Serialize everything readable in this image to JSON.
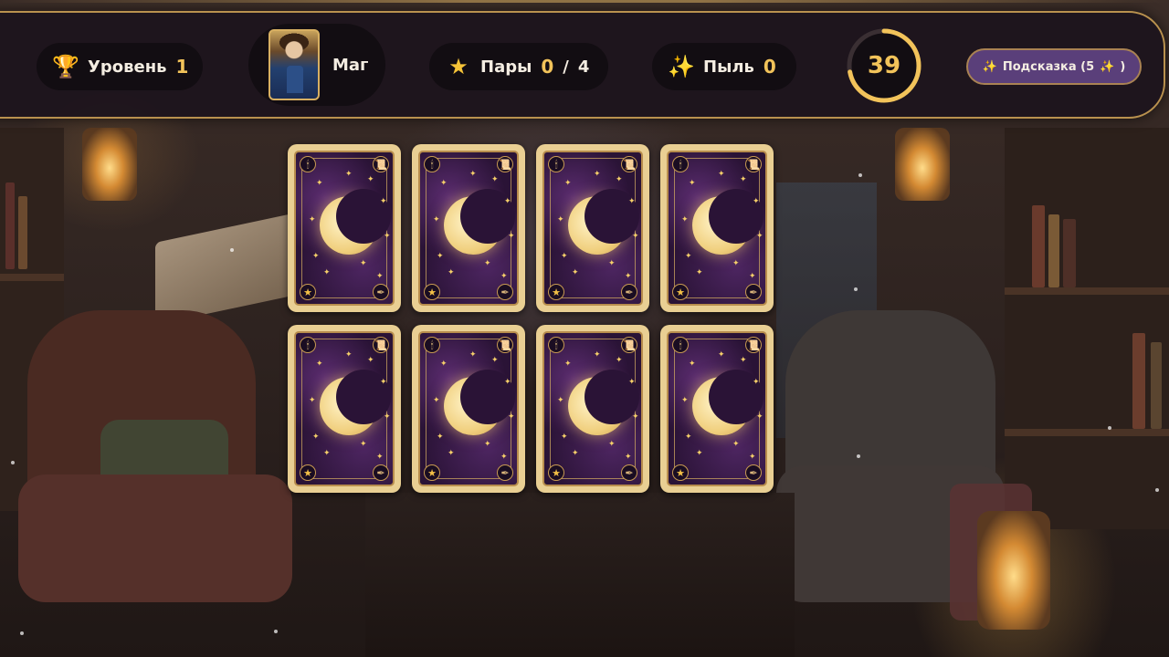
{
  "hud": {
    "level_label": "Уровень",
    "level_value": "1",
    "character_name": "Маг",
    "pairs_label": "Пары",
    "pairs_found": "0",
    "pairs_separator": "/",
    "pairs_total": "4",
    "dust_label": "Пыль",
    "dust_value": "0",
    "timer_value": "39",
    "timer_fraction": 0.72,
    "hint_label": "Подсказка (5",
    "hint_suffix": ")"
  },
  "icons": {
    "level": "trophy-icon",
    "pairs": "star-icon",
    "dust": "sparkles-icon",
    "hint": "sparkles-icon"
  },
  "colors": {
    "accent_gold": "#f2c35a",
    "bar_border": "#b9914e",
    "hint_button_bg": "#5a3f7a",
    "card_back": "#2a1336"
  },
  "board": {
    "rows": 2,
    "cols": 4,
    "cards": [
      {
        "id": 1,
        "state": "face-down"
      },
      {
        "id": 2,
        "state": "face-down"
      },
      {
        "id": 3,
        "state": "face-down"
      },
      {
        "id": 4,
        "state": "face-down"
      },
      {
        "id": 5,
        "state": "face-down"
      },
      {
        "id": 6,
        "state": "face-down"
      },
      {
        "id": 7,
        "state": "face-down"
      },
      {
        "id": 8,
        "state": "face-down"
      }
    ]
  }
}
